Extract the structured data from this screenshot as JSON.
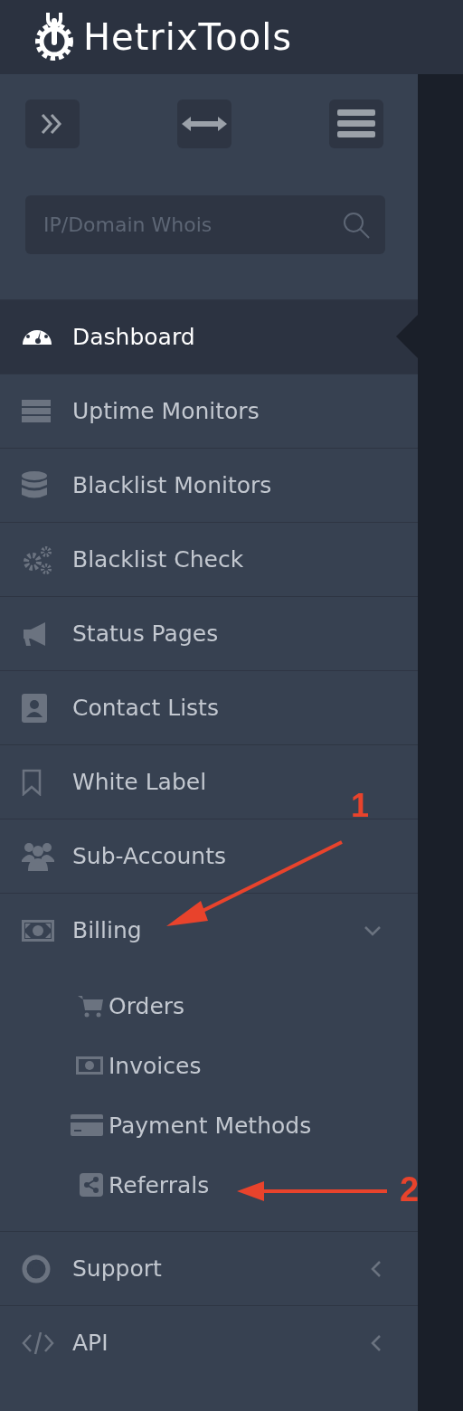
{
  "logo": {
    "text": "HetrixTools"
  },
  "search": {
    "placeholder": "IP/Domain Whois"
  },
  "menu": [
    {
      "label": "Dashboard",
      "selected": true
    },
    {
      "label": "Uptime Monitors",
      "selected": false
    },
    {
      "label": "Blacklist Monitors",
      "selected": false
    },
    {
      "label": "Blacklist Check",
      "selected": false
    },
    {
      "label": "Status Pages",
      "selected": false
    },
    {
      "label": "Contact Lists",
      "selected": false
    },
    {
      "label": "White Label",
      "selected": false
    },
    {
      "label": "Sub-Accounts",
      "selected": false
    },
    {
      "label": "Billing",
      "selected": false,
      "expanded": true,
      "children": [
        {
          "label": "Orders"
        },
        {
          "label": "Invoices"
        },
        {
          "label": "Payment Methods"
        },
        {
          "label": "Referrals"
        }
      ]
    },
    {
      "label": "Support",
      "selected": false,
      "expanded": false
    },
    {
      "label": "API",
      "selected": false,
      "expanded": false
    }
  ],
  "annotations": [
    {
      "label": "1"
    },
    {
      "label": "2"
    }
  ]
}
